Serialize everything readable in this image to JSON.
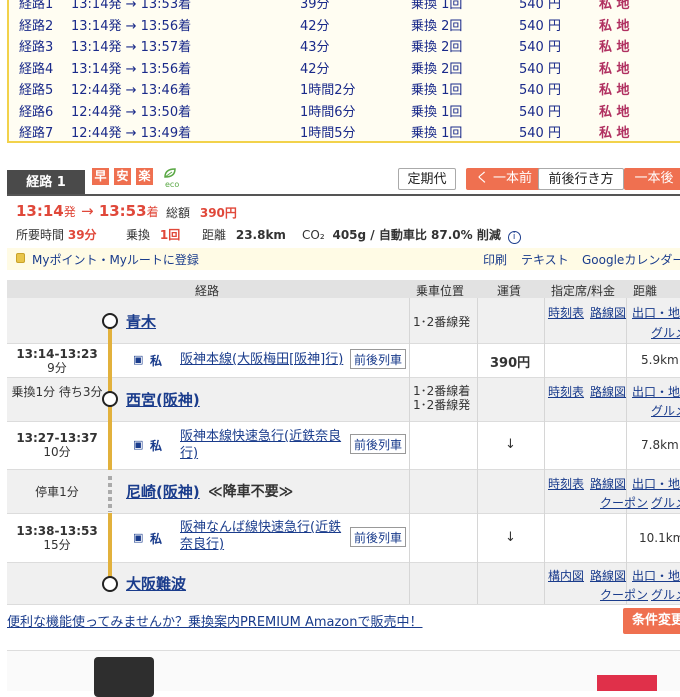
{
  "summary": {
    "routes": [
      {
        "name": "経路1",
        "time": "13:14発 → 13:53着",
        "duration": "39分",
        "transfers": "乗換 1回",
        "fare": "540 円",
        "marks": "私 地"
      },
      {
        "name": "経路2",
        "time": "13:14発 → 13:56着",
        "duration": "42分",
        "transfers": "乗換 2回",
        "fare": "540 円",
        "marks": "私 地"
      },
      {
        "name": "経路3",
        "time": "13:14発 → 13:57着",
        "duration": "43分",
        "transfers": "乗換 2回",
        "fare": "540 円",
        "marks": "私 地"
      },
      {
        "name": "経路4",
        "time": "13:14発 → 13:56着",
        "duration": "42分",
        "transfers": "乗換 2回",
        "fare": "540 円",
        "marks": "私 地"
      },
      {
        "name": "経路5",
        "time": "12:44発 → 13:46着",
        "duration": "1時間2分",
        "transfers": "乗換 1回",
        "fare": "540 円",
        "marks": "私 地"
      },
      {
        "name": "経路6",
        "time": "12:44発 → 13:50着",
        "duration": "1時間6分",
        "transfers": "乗換 1回",
        "fare": "540 円",
        "marks": "私 地"
      },
      {
        "name": "経路7",
        "time": "12:44発 → 13:49着",
        "duration": "1時間5分",
        "transfers": "乗換 1回",
        "fare": "540 円",
        "marks": "私 地"
      }
    ],
    "eco_label": "eco"
  },
  "tabbar": {
    "route_label": "経路 1",
    "badges": [
      "早",
      "安",
      "楽"
    ],
    "eco": "eco",
    "teiki": "定期代",
    "prev": "く 一本前",
    "around": "前後行き方",
    "next": "一本後"
  },
  "detail": {
    "depart": "13:14",
    "depart_suffix": "発",
    "arrow": "→",
    "arrive": "13:53",
    "arrive_suffix": "着",
    "total_label": "総額",
    "total_value": "390円",
    "time_label": "所要時間",
    "time_value": "39分",
    "transfer_label": "乗換",
    "transfer_value": "1回",
    "distance_label": "距離",
    "distance_value": "23.8km",
    "co2_label": "CO₂",
    "co2_value": "405g / 自動車比 87.0% 削減",
    "myline": "Myポイント・Myルートに登録",
    "print": "印刷",
    "text": "テキスト",
    "calendar": "Googleカレンダー"
  },
  "table": {
    "headers": {
      "route": "経路",
      "position": "乗車位置",
      "fare": "運賃",
      "seat": "指定席/料金",
      "distance": "距離"
    },
    "stations": {
      "s1": {
        "name": "青木",
        "platform": "1･2番線発",
        "links": [
          "時刻表",
          "路線図",
          "出口・地図",
          "グルメ"
        ]
      },
      "s2": {
        "name": "西宮(阪神)",
        "platform": "1･2番線着\n1･2番線発",
        "wait": "乗換1分\n待ち3分",
        "links": [
          "時刻表",
          "路線図",
          "出口・地図",
          "グルメ"
        ]
      },
      "s3": {
        "name": "尼崎(阪神)",
        "note": "≪降車不要≫",
        "stop": "停車1分",
        "links": [
          "時刻表",
          "路線図",
          "出口・地図",
          "クーポン",
          "グルメ"
        ]
      },
      "s4": {
        "name": "大阪難波",
        "links": [
          "構内図",
          "路線図",
          "出口・地図",
          "クーポン",
          "グルメ"
        ]
      }
    },
    "segments": [
      {
        "time": "13:14-13:23",
        "dur": "9分",
        "train": "阪神本線(大阪梅田[阪神]行)",
        "fare": "390円",
        "distance": "5.9km"
      },
      {
        "time": "13:27-13:37",
        "dur": "10分",
        "train": "阪神本線快速急行(近鉄奈良行)",
        "fare": "↓",
        "distance": "7.8km"
      },
      {
        "time": "13:38-13:53",
        "dur": "15分",
        "train": "阪神なんば線快速急行(近鉄奈良行)",
        "fare": "↓",
        "distance": "10.1km"
      }
    ],
    "train_icon": "私",
    "around_btn": "前後列車"
  },
  "promo": "便利な機能使ってみませんか？乗換案内PREMIUM Amazonで販売中！",
  "condition_btn": "条件変更"
}
